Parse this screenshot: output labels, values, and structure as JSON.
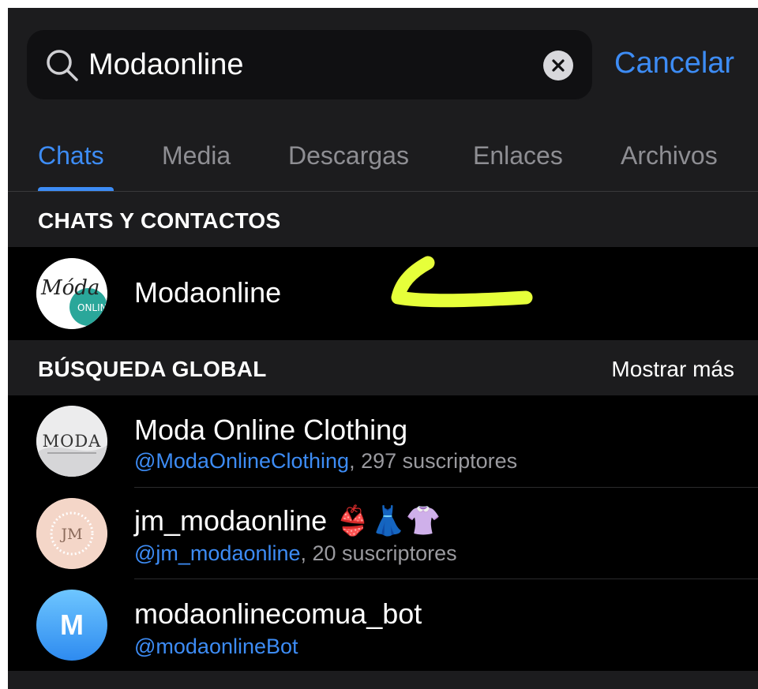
{
  "search": {
    "query": "Modaonline",
    "cancel_label": "Cancelar"
  },
  "tabs": [
    {
      "label": "Chats",
      "active": true
    },
    {
      "label": "Media",
      "active": false
    },
    {
      "label": "Descargas",
      "active": false
    },
    {
      "label": "Enlaces",
      "active": false
    },
    {
      "label": "Archivos",
      "active": false
    }
  ],
  "sections": {
    "chats_contacts": {
      "title": "CHATS Y CONTACTOS"
    },
    "global_search": {
      "title": "BÚSQUEDA GLOBAL",
      "action": "Mostrar más"
    }
  },
  "chat_results": [
    {
      "name": "Modaonline",
      "avatar_text": "Móda",
      "avatar_sub": "ONLINE"
    }
  ],
  "global_results": [
    {
      "name": "Moda Online Clothing",
      "handle": "@ModaOnlineClothing",
      "meta": ", 297 suscriptores",
      "avatar_text": "MODA"
    },
    {
      "name": "jm_modaonline",
      "emoji": "👙👗👚",
      "handle": "@jm_modaonline",
      "meta": ", 20 suscriptores",
      "avatar_text": "JM"
    },
    {
      "name": "modaonlinecomua_bot",
      "handle": "@modaonlineBot",
      "meta": "",
      "avatar_text": "M"
    }
  ],
  "colors": {
    "accent": "#3d8cf5",
    "annotation": "#e6ff3a"
  }
}
